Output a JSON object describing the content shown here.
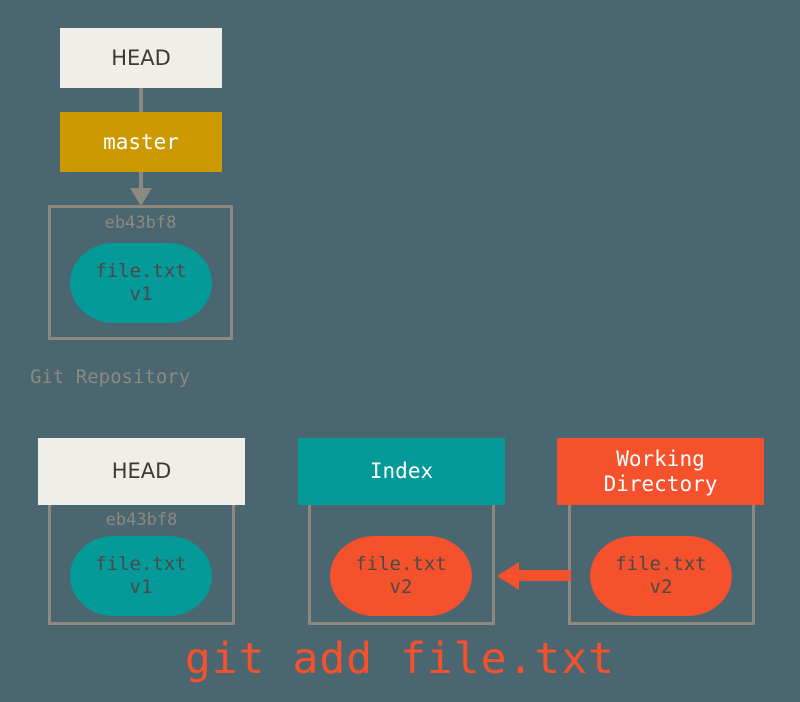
{
  "diagram": {
    "title": "git add file.txt",
    "background_color": "#4a6670",
    "frame_color": "#8d897f"
  },
  "repository": {
    "label": "Git Repository",
    "head": {
      "label": "HEAD",
      "color": "#efeee8"
    },
    "branch": {
      "label": "master",
      "color": "#cc9a00"
    },
    "commit": {
      "hash": "eb43bf8",
      "file": "file.txt",
      "version": "v1",
      "color": "#059a9a"
    }
  },
  "areas": [
    {
      "header": "HEAD",
      "header_color": "#efeee8",
      "hash": "eb43bf8",
      "file": "file.txt",
      "version": "v1",
      "blob_color": "#059a9a"
    },
    {
      "header": "Index",
      "header_color": "#059a9a",
      "hash": "",
      "file": "file.txt",
      "version": "v2",
      "blob_color": "#f4512c"
    },
    {
      "header_line1": "Working",
      "header_line2": "Directory",
      "header_color": "#f4512c",
      "hash": "",
      "file": "file.txt",
      "version": "v2",
      "blob_color": "#f4512c"
    }
  ],
  "arrow": {
    "direction": "left",
    "from": "Working Directory",
    "to": "Index",
    "color": "#f4512c"
  },
  "caption": {
    "text": "git add file.txt",
    "color": "#f4512c"
  }
}
